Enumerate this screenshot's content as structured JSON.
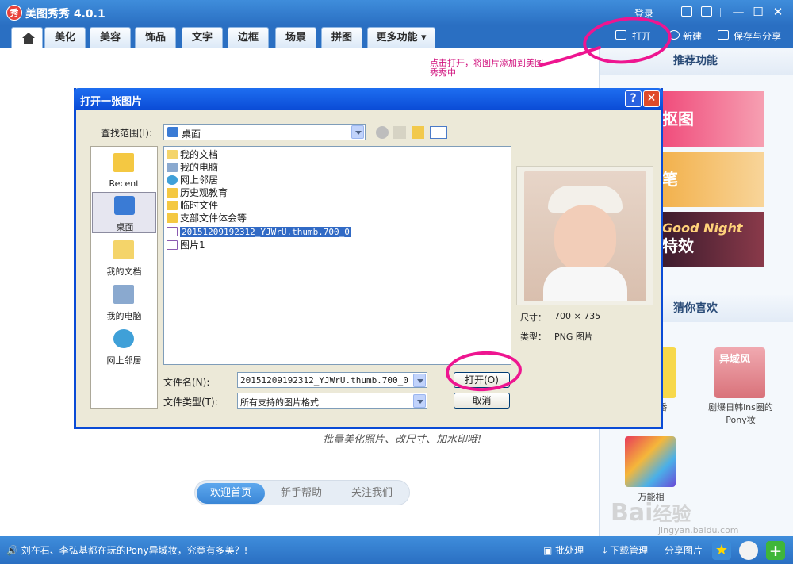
{
  "app": {
    "title": "美图秀秀 4.0.1",
    "logo_char": "秀",
    "login": "登录"
  },
  "tabs": [
    {
      "label": "美化"
    },
    {
      "label": "美容"
    },
    {
      "label": "饰品"
    },
    {
      "label": "文字"
    },
    {
      "label": "边框"
    },
    {
      "label": "场景"
    },
    {
      "label": "拼图"
    },
    {
      "label": "更多功能 ▾"
    }
  ],
  "top_actions": {
    "open": "打开",
    "new": "新建",
    "save_share": "保存与分享"
  },
  "annotation": "点击打开，将图片添加到美图秀秀中",
  "main": {
    "script_hint": "批量美化照片、改尺寸、加水印哦!",
    "bottom_tabs": [
      {
        "label": "欢迎首页"
      },
      {
        "label": "新手帮助"
      },
      {
        "label": "关注我们"
      }
    ]
  },
  "sidebar": {
    "recommend_title": "推荐功能",
    "banners": [
      {
        "text": "抠图"
      },
      {
        "text": "笔"
      },
      {
        "text": "特效"
      }
    ],
    "banner_overlay": "Good Night",
    "guess_title": "猜你喜欢",
    "guess_items": [
      {
        "label": "剧爆日韩ins圈的Pony妆"
      },
      {
        "label": "万能相"
      }
    ],
    "guess_left_fragment": "番",
    "thumb_text": "异域风"
  },
  "statusbar": {
    "marquee": "刘在石、李弘基都在玩的Pony异域妆，究竟有多美？!",
    "batch": "批处理",
    "download": "下载管理",
    "share": "分享图片"
  },
  "watermark": {
    "brand": "Bai",
    "brand2": "经验",
    "url": "jingyan.baidu.com"
  },
  "dialog": {
    "title": "打开一张图片",
    "help": "?",
    "close": "✕",
    "look_in_label": "查找范围(I):",
    "look_in_value": "桌面",
    "places": [
      {
        "label": "Recent"
      },
      {
        "label": "桌面"
      },
      {
        "label": "我的文档"
      },
      {
        "label": "我的电脑"
      },
      {
        "label": "网上邻居"
      }
    ],
    "files": [
      {
        "name": "我的文档",
        "icon": "folder-docs-icon"
      },
      {
        "name": "我的电脑",
        "icon": "computer-icon"
      },
      {
        "name": "网上邻居",
        "icon": "network-icon"
      },
      {
        "name": "历史观教育",
        "icon": "folder-icon"
      },
      {
        "name": "临时文件",
        "icon": "folder-icon"
      },
      {
        "name": "支部文件体会等",
        "icon": "folder-icon"
      },
      {
        "name": "20151209192312_YJWrU.thumb.700_0",
        "icon": "png-file-icon",
        "selected": true
      },
      {
        "name": "图片1",
        "icon": "png-file-icon"
      }
    ],
    "size_label": "尺寸：",
    "size_value": "700 × 735",
    "type_label": "类型：",
    "type_value": "PNG 图片",
    "filename_label": "文件名(N):",
    "filename_value": "20151209192312_YJWrU.thumb.700_0",
    "filetype_label": "文件类型(T):",
    "filetype_value": "所有支持的图片格式",
    "open_button": "打开(O)",
    "cancel_button": "取消"
  },
  "colors": {
    "accent": "#2a6fc2",
    "highlight": "#ee1590",
    "selection": "#316ac5"
  }
}
